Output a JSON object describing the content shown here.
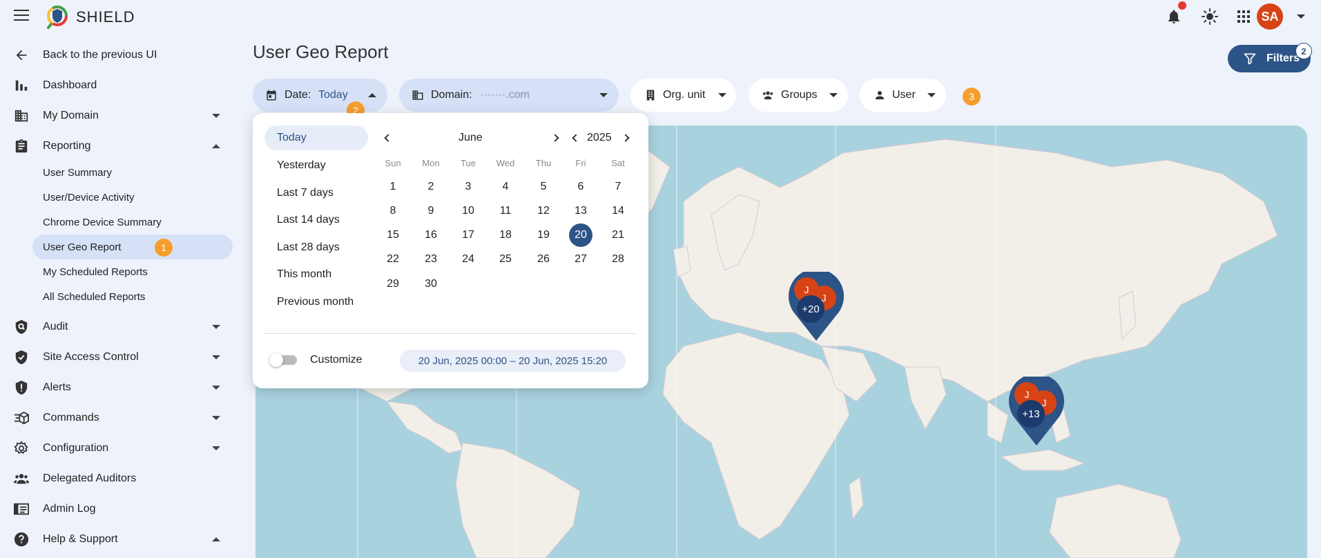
{
  "app": {
    "brand": "SHIELD"
  },
  "header": {
    "user_initials": "SA",
    "notification_indicator": true
  },
  "sidebar": {
    "items": [
      {
        "label": "Back to the previous UI",
        "icon": "arrow-left-icon"
      },
      {
        "label": "Dashboard",
        "icon": "bar-chart-icon"
      },
      {
        "label": "My Domain",
        "icon": "building-icon",
        "expandable": true
      },
      {
        "label": "Reporting",
        "icon": "clipboard-icon",
        "expanded": true
      },
      {
        "label": "Audit",
        "icon": "audit-icon",
        "expandable": true
      },
      {
        "label": "Site Access Control",
        "icon": "shield-check-icon",
        "expandable": true
      },
      {
        "label": "Alerts",
        "icon": "alert-shield-icon",
        "expandable": true
      },
      {
        "label": "Commands",
        "icon": "commands-icon",
        "expandable": true
      },
      {
        "label": "Configuration",
        "icon": "gear-icon",
        "expandable": true
      },
      {
        "label": "Delegated Auditors",
        "icon": "people-icon"
      },
      {
        "label": "Admin Log",
        "icon": "log-icon"
      },
      {
        "label": "Help & Support",
        "icon": "help-icon",
        "expanded": true
      }
    ],
    "reporting_sub": [
      "User Summary",
      "User/Device Activity",
      "Chrome Device Summary",
      "User Geo Report",
      "My Scheduled Reports",
      "All Scheduled Reports"
    ],
    "active_sub": "User Geo Report"
  },
  "badges": {
    "b1": "1",
    "b2": "2",
    "b3": "3"
  },
  "main": {
    "title": "User Geo Report",
    "filters_label": "Filters",
    "filters_count": "2",
    "chips": {
      "date_label": "Date:",
      "date_value": "Today",
      "domain_label": "Domain:",
      "domain_value": "·······.com",
      "org_unit": "Org. unit",
      "groups": "Groups",
      "user": "User"
    }
  },
  "date_picker": {
    "presets": [
      "Today",
      "Yesterday",
      "Last 7 days",
      "Last 14 days",
      "Last 28 days",
      "This month",
      "Previous month"
    ],
    "active_preset": "Today",
    "month": "June",
    "year": "2025",
    "weekdays": [
      "Sun",
      "Mon",
      "Tue",
      "Wed",
      "Thu",
      "Fri",
      "Sat"
    ],
    "weeks": [
      [
        "1",
        "2",
        "3",
        "4",
        "5",
        "6",
        "7"
      ],
      [
        "8",
        "9",
        "10",
        "11",
        "12",
        "13",
        "14"
      ],
      [
        "15",
        "16",
        "17",
        "18",
        "19",
        "20",
        "21"
      ],
      [
        "22",
        "23",
        "24",
        "25",
        "26",
        "27",
        "28"
      ],
      [
        "29",
        "30",
        "",
        "",
        "",
        "",
        ""
      ]
    ],
    "selected_day": "20",
    "customize_label": "Customize",
    "customize_on": false,
    "range_text": "20 Jun, 2025 00:00 – 20 Jun, 2025 15:20"
  },
  "map": {
    "markers": [
      {
        "initials": [
          "J",
          "J"
        ],
        "count": "+20",
        "region": "europe"
      },
      {
        "initials": [
          "J",
          "J"
        ],
        "count": "+13",
        "region": "east-asia"
      }
    ],
    "colors": {
      "water": "#a9d2df",
      "land": "#f2efe9",
      "marker": "#2d5486",
      "user": "#d84315"
    }
  }
}
